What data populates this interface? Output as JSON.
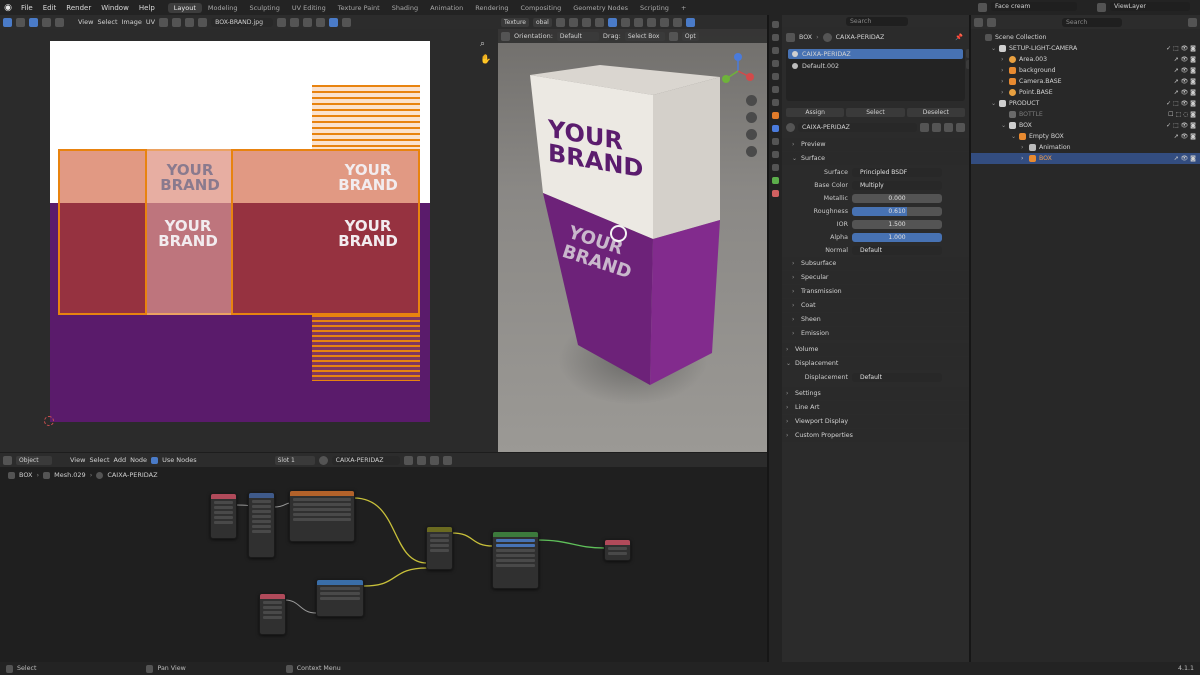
{
  "menu": {
    "items": [
      "File",
      "Edit",
      "Render",
      "Window",
      "Help"
    ]
  },
  "workspaces": {
    "tabs": [
      "Layout",
      "Modeling",
      "Sculpting",
      "UV Editing",
      "Texture Paint",
      "Shading",
      "Animation",
      "Rendering",
      "Compositing",
      "Geometry Nodes",
      "Scripting"
    ],
    "active": "Layout",
    "add": "+"
  },
  "topright": {
    "scene": "Face cream",
    "viewlayer": "ViewLayer"
  },
  "uv": {
    "menus": [
      "View",
      "Select",
      "Image",
      "UV"
    ],
    "image_name": "BOX-BRAND.jpg",
    "brand_line1": "YOUR",
    "brand_line2": "BRAND"
  },
  "viewport": {
    "orientation_label": "Orientation:",
    "orientation_value": "Default",
    "drag_label": "Drag:",
    "drag_value": "Select Box",
    "options": "Opt",
    "texture": "Texture",
    "global": "obal",
    "brand_line1": "YOUR",
    "brand_line2": "BRAND"
  },
  "props": {
    "crumb_object": "BOX",
    "crumb_material": "CAIXA-PERIDAZ",
    "slots": [
      "CAIXA-PERIDAZ",
      "Default.002"
    ],
    "assign": "Assign",
    "select": "Select",
    "deselect": "Deselect",
    "material_name": "CAIXA-PERIDAZ",
    "preview": "Preview",
    "surface": "Surface",
    "surface_label": "Surface",
    "surface_value": "Principled BSDF",
    "basecolor_label": "Base Color",
    "basecolor_value": "Multiply",
    "metallic_label": "Metallic",
    "metallic_value": "0.000",
    "roughness_label": "Roughness",
    "roughness_value": "0.610",
    "roughness": 0.61,
    "ior_label": "IOR",
    "ior_value": "1.500",
    "alpha_label": "Alpha",
    "alpha_value": "1.000",
    "alpha": 1.0,
    "normal_label": "Normal",
    "normal_value": "Default",
    "subsections": [
      "Subsurface",
      "Specular",
      "Transmission",
      "Coat",
      "Sheen",
      "Emission"
    ],
    "volume": "Volume",
    "displacement": "Displacement",
    "displacement_label": "Displacement",
    "displacement_value": "Default",
    "tail": [
      "Settings",
      "Line Art",
      "Viewport Display",
      "Custom Properties"
    ]
  },
  "outliner": {
    "search": "Search",
    "root": "Scene Collection",
    "items": [
      {
        "label": "SETUP-LIGHT-CAMERA"
      },
      {
        "label": "Area.003"
      },
      {
        "label": "background"
      },
      {
        "label": "Camera.BASE"
      },
      {
        "label": "Point.BASE"
      },
      {
        "label": "PRODUCT"
      },
      {
        "label": "BOTTLE"
      },
      {
        "label": "BOX"
      },
      {
        "label": "Empty BOX"
      },
      {
        "label": "Animation"
      },
      {
        "label": "BOX"
      }
    ]
  },
  "nodes": {
    "mode": "Object",
    "menus": [
      "View",
      "Select",
      "Add",
      "Node"
    ],
    "use_nodes": "Use Nodes",
    "slot": "Slot 1",
    "material": "CAIXA-PERIDAZ",
    "crumb": [
      "BOX",
      "Mesh.029",
      "CAIXA-PERIDAZ"
    ]
  },
  "status": {
    "select": "Select",
    "pan": "Pan View",
    "context": "Context Menu",
    "version": "4.1.1"
  },
  "search_placeholder": "Search",
  "colors": {
    "accent": "#4772b3",
    "purple": "#5b1c6e",
    "uv_orange": "#f08a1a",
    "brand_gray": "#5a4a5f"
  }
}
